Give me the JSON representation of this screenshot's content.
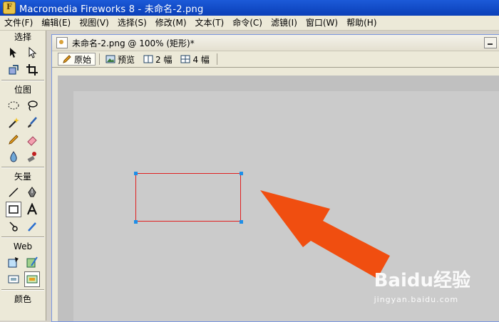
{
  "app": {
    "title": "Macromedia Fireworks 8 - 未命名-2.png"
  },
  "menu": [
    "文件(F)",
    "编辑(E)",
    "视图(V)",
    "选择(S)",
    "修改(M)",
    "文本(T)",
    "命令(C)",
    "滤镜(I)",
    "窗口(W)",
    "帮助(H)"
  ],
  "tools": {
    "sections": {
      "select": "选择",
      "bitmap": "位图",
      "vector": "矢量",
      "web": "Web",
      "colors": "颜色"
    },
    "selected_tool": "rectangle-tool"
  },
  "document": {
    "title": "未命名-2.png @ 100% (矩形)*",
    "tabs": [
      {
        "label": "原始",
        "icon": "pencil-icon",
        "active": true
      },
      {
        "label": "预览",
        "icon": "image-icon",
        "active": false
      },
      {
        "label": "2 幅",
        "icon": "two-up-icon",
        "active": false
      },
      {
        "label": "4 幅",
        "icon": "four-up-icon",
        "active": false
      }
    ]
  },
  "canvas": {
    "shape": "rectangle",
    "shape_stroke_color": "#e02020",
    "handle_color": "#1e8fe8",
    "arrow_color": "#f04e10"
  },
  "watermark": {
    "brand": "Baidu经验",
    "sub": "jingyan.baidu.com"
  }
}
